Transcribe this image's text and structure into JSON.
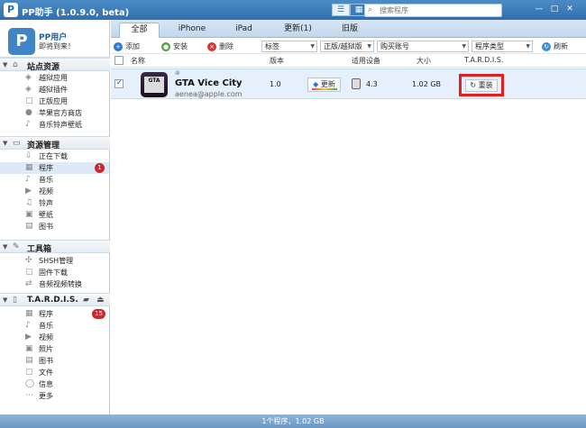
{
  "window": {
    "title": "PP助手 (1.0.9.0, beta)",
    "search_placeholder": "搜索程序",
    "minimize": "—",
    "maximize": "□",
    "close": "✕"
  },
  "user": {
    "avatar_glyph": "P",
    "name": "PP用户",
    "message": "即将到来！"
  },
  "sidebar": {
    "sections": [
      {
        "name": "站点资源",
        "items": [
          "越狱应用",
          "越狱插件",
          "正版应用",
          "苹果官方商店",
          "音乐铃声壁纸"
        ]
      },
      {
        "name": "资源管理",
        "items": [
          "正在下载",
          "程序",
          "音乐",
          "视频",
          "铃声",
          "壁纸",
          "图书"
        ]
      },
      {
        "name": "工具箱",
        "items": [
          "SHSH管理",
          "固件下载",
          "音频视频转换"
        ]
      },
      {
        "name": "T.A.R.D.I.S.",
        "items": [
          "程序",
          "音乐",
          "视频",
          "照片",
          "图书",
          "文件",
          "信息",
          "更多"
        ]
      }
    ],
    "badges": {
      "programs": "1",
      "tardis_programs": "15"
    }
  },
  "tabs": [
    "全部",
    "iPhone",
    "iPad",
    "更新(1)",
    "旧版"
  ],
  "toolbar": {
    "add": "添加",
    "install": "安装",
    "delete": "删除",
    "filter_tags": "标签",
    "filter_version": "正版/越狱版",
    "filter_account": "购买账号",
    "filter_type": "程序类型",
    "refresh": "刷新"
  },
  "columns": [
    "名称",
    "版本",
    "适用设备",
    "大小",
    "T.A.R.D.I.S."
  ],
  "apps": [
    {
      "name": "GTA Vice City",
      "account": "aenea@apple.com",
      "version": "1.0",
      "update_label": "更新",
      "device_version": "4.3",
      "size": "1.02 GB",
      "tardis_action": "重装"
    }
  ],
  "status": "1个程序，1.02 GB",
  "colors": {
    "titlebar": "#2f6fae",
    "badge": "#c9282d",
    "highlight": "#e11f1f",
    "row_selected": "#e6f0fa"
  }
}
